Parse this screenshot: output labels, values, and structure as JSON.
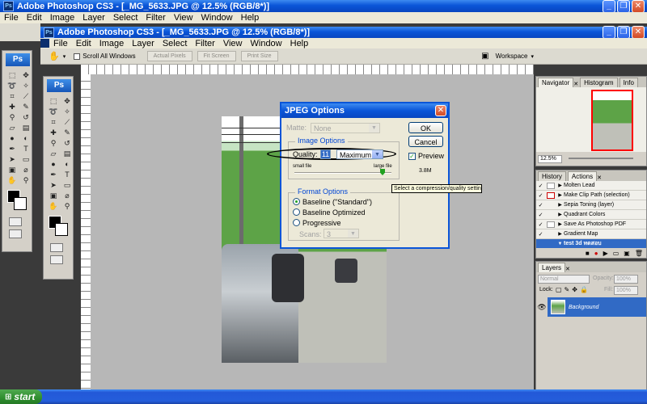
{
  "app": {
    "outer_title": "Adobe Photoshop CS3 - [_MG_5633.JPG @ 12.5% (RGB/8*)]",
    "inner_title": "Adobe Photoshop CS3 - [_MG_5633.JPG @ 12.5% (RGB/8*)]",
    "ps_logo": "Ps"
  },
  "menu": [
    "File",
    "Edit",
    "Image",
    "Layer",
    "Select",
    "Filter",
    "View",
    "Window",
    "Help"
  ],
  "options_bar": {
    "scroll_all": "Scroll All Windows",
    "actual_pixels": "Actual Pixels",
    "fit_screen": "Fit Screen",
    "print_size": "Print Size",
    "workspace": "Workspace"
  },
  "dialog": {
    "title": "JPEG Options",
    "matte_label": "Matte:",
    "matte_value": "None",
    "image_options_legend": "Image Options",
    "quality_label": "Quality:",
    "quality_value": "11",
    "quality_preset": "Maximum",
    "small_file": "small file",
    "large_file": "large file",
    "format_options_legend": "Format Options",
    "format_options": [
      {
        "label": "Baseline (\"Standard\")",
        "selected": true
      },
      {
        "label": "Baseline Optimized",
        "selected": false
      },
      {
        "label": "Progressive",
        "selected": false
      }
    ],
    "scans_label": "Scans:",
    "scans_value": "3",
    "ok": "OK",
    "cancel": "Cancel",
    "preview": "Preview",
    "file_size": "3.8M",
    "tooltip": "Select a compression/quality setting"
  },
  "navigator": {
    "tabs": [
      "Navigator",
      "Histogram",
      "Info"
    ],
    "zoom": "12.5%"
  },
  "actions": {
    "tabs": [
      "History",
      "Actions"
    ],
    "items": [
      "Molten Lead",
      "Make Clip Path (selection)",
      "Sepia Toning (layer)",
      "Quadrant Colors",
      "Save As Photoshop PDF",
      "Gradient Map"
    ],
    "custom_set": "test 3d ทดสอบ"
  },
  "layers": {
    "tab": "Layers",
    "blend_mode": "Normal",
    "opacity_label": "Opacity:",
    "opacity_value": "100%",
    "lock_label": "Lock:",
    "fill_label": "Fill:",
    "fill_value": "100%",
    "layer_name": "Background"
  },
  "taskbar": {
    "start": "start"
  },
  "colors": {
    "xp_blue": "#0a55d8",
    "selection_blue": "#316ac5",
    "canvas_bg": "#b7b7b7"
  }
}
